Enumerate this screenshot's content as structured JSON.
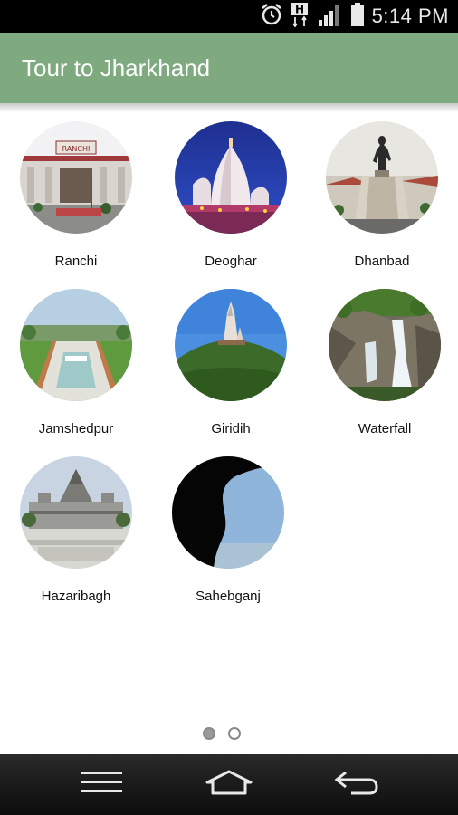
{
  "status_bar": {
    "time": "5:14 PM",
    "icons": [
      "alarm-icon",
      "h-signal-icon",
      "signal-bars-icon",
      "battery-icon"
    ]
  },
  "app_bar": {
    "title": "Tour to Jharkhand",
    "background": "#7faa7f"
  },
  "places": [
    {
      "name": "Ranchi",
      "image": "station-building"
    },
    {
      "name": "Deoghar",
      "image": "temple-at-night"
    },
    {
      "name": "Dhanbad",
      "image": "statue-monument"
    },
    {
      "name": "Jamshedpur",
      "image": "garden-fountain"
    },
    {
      "name": "Giridih",
      "image": "hill-temple"
    },
    {
      "name": "Waterfall",
      "image": "waterfall"
    },
    {
      "name": "Hazaribagh",
      "image": "white-temple"
    },
    {
      "name": "Sahebganj",
      "image": "cave-opening"
    }
  ],
  "pager": {
    "pages": 2,
    "current": 1
  },
  "nav_bar": {
    "buttons": [
      "menu-icon",
      "home-icon",
      "back-icon"
    ]
  }
}
